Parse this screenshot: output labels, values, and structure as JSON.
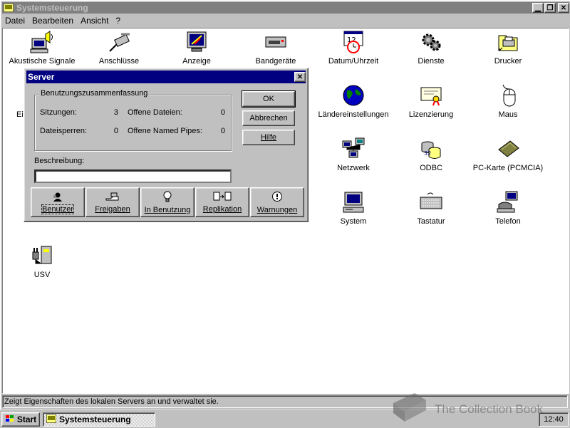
{
  "window": {
    "title": "Systemsteuerung",
    "menu": [
      "Datei",
      "Bearbeiten",
      "Ansicht",
      "?"
    ]
  },
  "items": [
    {
      "label": "Akustische Signale",
      "icon": "speaker-pc-icon"
    },
    {
      "label": "Anschlüsse",
      "icon": "plug-icon"
    },
    {
      "label": "Anzeige",
      "icon": "display-icon"
    },
    {
      "label": "Bandgeräte",
      "icon": "tape-drive-icon"
    },
    {
      "label": "Datum/Uhrzeit",
      "icon": "calendar-clock-icon"
    },
    {
      "label": "Dienste",
      "icon": "gears-icon"
    },
    {
      "label": "Drucker",
      "icon": "printer-folder-icon"
    },
    {
      "label": "Ländereinstellungen",
      "icon": "globe-icon"
    },
    {
      "label": "Lizenzierung",
      "icon": "certificate-icon"
    },
    {
      "label": "Maus",
      "icon": "mouse-icon"
    },
    {
      "label": "Netzwerk",
      "icon": "network-icon"
    },
    {
      "label": "ODBC",
      "icon": "odbc-icon"
    },
    {
      "label": "PC-Karte (PCMCIA)",
      "icon": "pccard-icon"
    },
    {
      "label": "System",
      "icon": "computer-icon"
    },
    {
      "label": "Tastatur",
      "icon": "keyboard-icon"
    },
    {
      "label": "Telefon",
      "icon": "telephone-icon"
    },
    {
      "label": "USV",
      "icon": "ups-icon"
    }
  ],
  "status": "Zeigt Eigenschaften des lokalen Servers an und verwaltet sie.",
  "taskbar": {
    "start": "Start",
    "task": "Systemsteuerung",
    "clock": "12:40"
  },
  "dialog": {
    "title": "Server",
    "group_title": "Benutzungszusammenfassung",
    "sessions_label": "Sitzungen:",
    "sessions_value": "3",
    "open_files_label": "Offene Dateien:",
    "open_files_value": "0",
    "file_locks_label": "Dateisperren:",
    "file_locks_value": "0",
    "named_pipes_label": "Offene Named Pipes:",
    "named_pipes_value": "0",
    "ok": "OK",
    "cancel": "Abbrechen",
    "help": "Hilfe",
    "desc_label": "Beschreibung:",
    "desc_value": "",
    "buttons": [
      "Benutzer",
      "Freigaben",
      "In Benutzung",
      "Replikation",
      "Warnungen"
    ]
  },
  "watermark": "The Collection Book"
}
